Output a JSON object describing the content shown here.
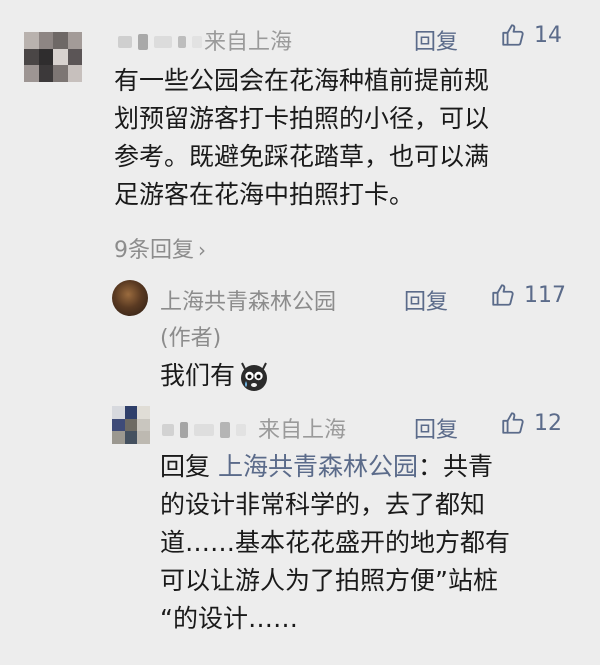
{
  "comment": {
    "location": "来自上海",
    "reply_label": "回复",
    "likes": "14",
    "text_lines": [
      "有一些公园会在花海种植前提前规",
      "划预留游客打卡拍照的小径，可以",
      "参考。既避免踩花踏草，也可以满",
      "足游客在花海中拍照打卡。"
    ],
    "replies_count_label": "9条回复"
  },
  "reply1": {
    "author": "上海共青森林公园",
    "role": "(作者)",
    "reply_label": "回复",
    "likes": "117",
    "text": "我们有",
    "emoji_icon": "crying-face-emoji"
  },
  "reply2": {
    "location": "来自上海",
    "reply_label": "回复",
    "likes": "12",
    "prefix": "回复",
    "mention": "上海共青森林公园",
    "first_line_rest": "：共青",
    "text_lines": [
      "的设计非常科学的，去了都知",
      "道……基本花花盛开的地方都有",
      "可以让游人为了拍照方便”站桩",
      "“的设计……"
    ]
  },
  "colors": {
    "background": "#ededed",
    "link": "#5b6b8a",
    "meta": "#9a9a9a",
    "text": "#1a1a1a"
  }
}
